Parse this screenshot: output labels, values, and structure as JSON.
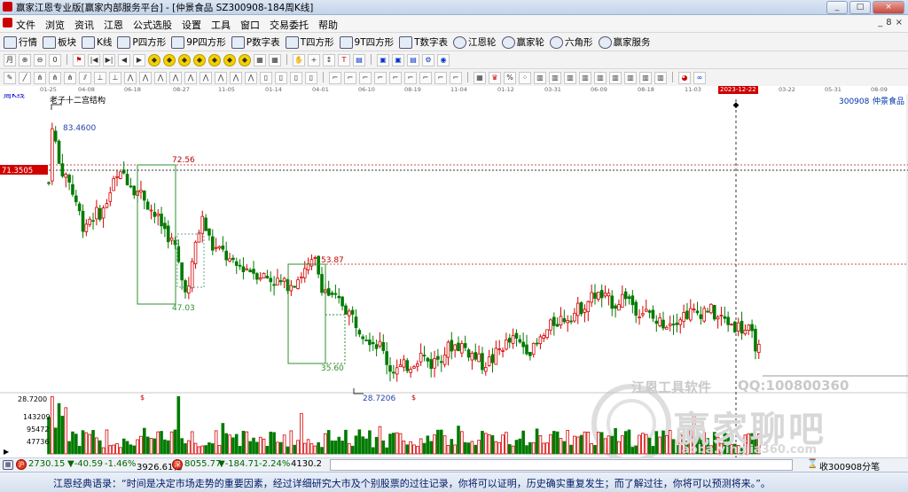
{
  "window": {
    "title": "赢家江恩专业版[赢家内部服务平台] - [仲景食品  SZ300908-184周K线]",
    "min": "_",
    "max": "□",
    "close": "×"
  },
  "menu": [
    "文件",
    "浏览",
    "资讯",
    "江恩",
    "公式选股",
    "设置",
    "工具",
    "窗口",
    "交易委托",
    "帮助"
  ],
  "mdi_buttons": [
    "_",
    "8",
    "×"
  ],
  "toolbar1": [
    {
      "icon": "grid-icon",
      "label": "行情"
    },
    {
      "icon": "blocks-icon",
      "label": "板块"
    },
    {
      "icon": "kline-icon",
      "label": "K线"
    },
    {
      "icon": "p-square-icon",
      "label": "P四方形"
    },
    {
      "icon": "9p-square-icon",
      "label": "9P四方形"
    },
    {
      "icon": "p-table-icon",
      "label": "P数字表"
    },
    {
      "icon": "t-square-icon",
      "label": "T四方形"
    },
    {
      "icon": "9t-square-icon",
      "label": "9T四方形"
    },
    {
      "icon": "t-table-icon",
      "label": "T数字表"
    },
    {
      "icon": "gann-wheel-icon",
      "label": "江恩轮"
    },
    {
      "icon": "winner-wheel-icon",
      "label": "赢家轮"
    },
    {
      "icon": "hexagon-icon",
      "label": "六角形"
    },
    {
      "icon": "dollar-icon",
      "label": "赢家服务"
    }
  ],
  "date_axis": {
    "labels": [
      "01-25",
      "04-08",
      "06-18",
      "08-27",
      "11-05",
      "01-14",
      "04-01",
      "06-10",
      "08-19",
      "11-04",
      "01-12",
      "03-31",
      "06-09",
      "08-18",
      "11-03",
      "2023-12-22",
      "03-22",
      "05-31",
      "08-09"
    ]
  },
  "chart": {
    "period_label": "周K线",
    "stock_code": "300908",
    "stock_name": "仲景食品",
    "structure_label": "老子十二宫结构",
    "price_tag": "71.3505",
    "high_label": "83.4600",
    "low_label": "28.7200",
    "vol_axis_top": "28.7200",
    "box_labels": [
      "72.56",
      "47.03",
      "53.87",
      "35.60"
    ],
    "volume_ticks": [
      "143209",
      "95472",
      "47736"
    ],
    "dollar_marker": "$",
    "colors": {
      "up": "#d60000",
      "down": "#007a00",
      "dotted": "#c85050",
      "accent": "#c00000"
    }
  },
  "chart_data": {
    "type": "candlestick",
    "title": "",
    "y_axis_labels": [
      "83.4600",
      "72.56",
      "71.3505",
      "53.87",
      "47.03",
      "35.60",
      "28.7200"
    ],
    "ylim": [
      25,
      88
    ],
    "pivots": [
      {
        "label": "83.4600",
        "value": 83.46
      },
      {
        "label": "72.56",
        "value": 72.56
      },
      {
        "label": "53.87",
        "value": 53.87
      },
      {
        "label": "47.03",
        "value": 47.03
      },
      {
        "label": "35.60",
        "value": 35.6
      },
      {
        "label": "28.7206",
        "value": 28.7206
      }
    ],
    "path_points": [
      [
        0,
        70
      ],
      [
        1,
        83
      ],
      [
        3,
        74
      ],
      [
        6,
        70
      ],
      [
        8,
        66
      ],
      [
        10,
        61
      ],
      [
        13,
        63
      ],
      [
        16,
        64
      ],
      [
        19,
        70
      ],
      [
        22,
        72
      ],
      [
        25,
        69
      ],
      [
        28,
        67
      ],
      [
        31,
        63
      ],
      [
        34,
        60
      ],
      [
        37,
        56
      ],
      [
        39,
        49
      ],
      [
        41,
        47
      ],
      [
        43,
        57
      ],
      [
        45,
        62
      ],
      [
        48,
        56
      ],
      [
        51,
        55
      ],
      [
        54,
        52
      ],
      [
        57,
        52
      ],
      [
        60,
        51
      ],
      [
        63,
        50
      ],
      [
        66,
        49
      ],
      [
        69,
        48
      ],
      [
        72,
        49
      ],
      [
        75,
        51
      ],
      [
        78,
        53
      ],
      [
        80,
        48
      ],
      [
        83,
        45
      ],
      [
        86,
        44
      ],
      [
        89,
        41
      ],
      [
        92,
        38
      ],
      [
        95,
        36
      ],
      [
        97,
        35
      ],
      [
        100,
        30
      ],
      [
        103,
        30
      ],
      [
        106,
        31
      ],
      [
        109,
        33
      ],
      [
        112,
        31
      ],
      [
        115,
        33
      ],
      [
        118,
        35
      ],
      [
        121,
        35
      ],
      [
        124,
        33
      ],
      [
        127,
        31
      ],
      [
        130,
        32
      ],
      [
        133,
        35
      ],
      [
        136,
        36
      ],
      [
        139,
        35
      ],
      [
        142,
        34
      ],
      [
        145,
        37
      ],
      [
        148,
        40
      ],
      [
        151,
        41
      ],
      [
        154,
        42
      ],
      [
        157,
        44
      ],
      [
        160,
        46
      ],
      [
        163,
        45
      ],
      [
        166,
        44
      ],
      [
        169,
        46
      ],
      [
        172,
        43
      ],
      [
        175,
        42
      ],
      [
        178,
        40
      ],
      [
        181,
        40
      ],
      [
        184,
        41
      ],
      [
        187,
        42
      ],
      [
        190,
        42
      ],
      [
        193,
        43
      ],
      [
        196,
        41
      ],
      [
        199,
        40
      ],
      [
        202,
        39
      ],
      [
        205,
        38
      ],
      [
        208,
        34
      ]
    ]
  },
  "status_bar": {
    "sh_index": "2730.15",
    "sh_change": "▼-40.59",
    "sh_pct": "-1.46%",
    "sh_amount": "3926.61亿",
    "sz_index": "8055.77",
    "sz_change": "▼-184.71",
    "sz_pct": "-2.24%",
    "sz_amount": "4130.2",
    "right_label": "收300908分笔"
  },
  "quote": "江恩经典语录：“时间是决定市场走势的重要因素，经过详细研究大市及个别股票的过往记录，你将可以证明，历史确实重复发生；而了解过往，你将可以预测将来。”。",
  "watermark": {
    "software": "江恩工具软件",
    "qq": "QQ:100800360",
    "forum": "赢家聊吧",
    "url": "liaoba.yingjia360.com"
  }
}
